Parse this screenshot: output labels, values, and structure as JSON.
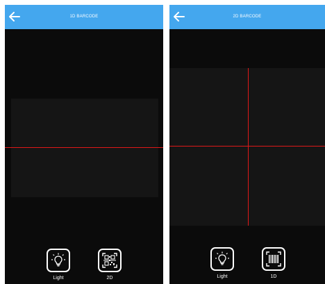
{
  "screens": [
    {
      "title": "1D BARCODE",
      "back_icon": "arrow-left-icon",
      "actions": [
        {
          "label": "Light",
          "icon": "lightbulb-icon"
        },
        {
          "label": "2D",
          "icon": "qr-code-icon"
        }
      ]
    },
    {
      "title": "2D BARCODE",
      "back_icon": "arrow-left-icon",
      "actions": [
        {
          "label": "Light",
          "icon": "lightbulb-icon"
        },
        {
          "label": "1D",
          "icon": "barcode-icon"
        }
      ]
    }
  ],
  "colors": {
    "appbar": "#44a7ee",
    "camera_background": "#0b0b0b",
    "scan_area": "#151515",
    "scan_line": "#e01818"
  }
}
